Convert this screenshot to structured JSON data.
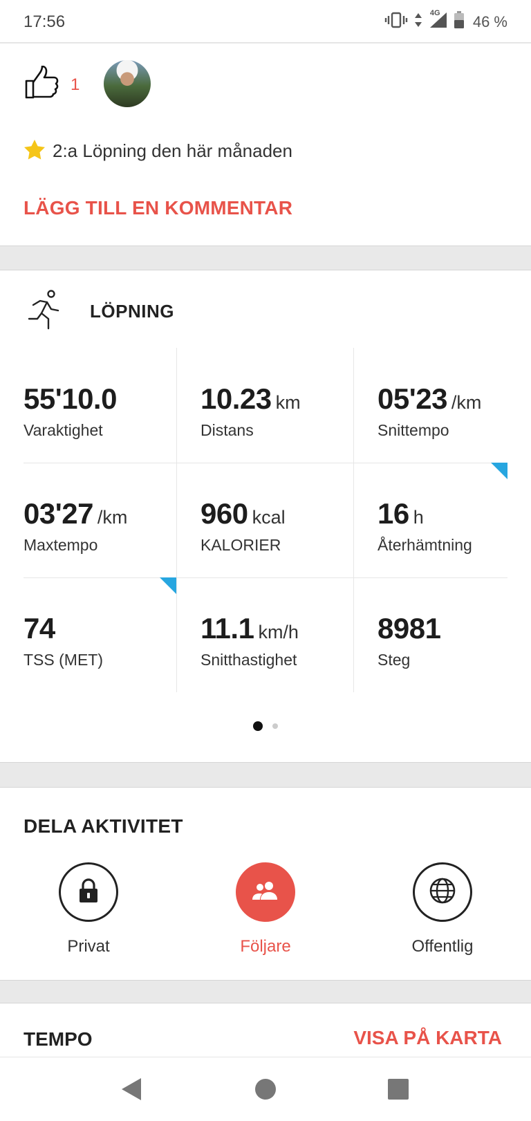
{
  "status_bar": {
    "time": "17:56",
    "network": "4G",
    "battery": "46 %"
  },
  "social": {
    "like_count": "1",
    "achievement": "2:a Löpning den här månaden",
    "add_comment": "LÄGG TILL EN KOMMENTAR"
  },
  "activity": {
    "title": "LÖPNING",
    "stats": [
      {
        "value": "55'10.0",
        "unit": "",
        "label": "Varaktighet"
      },
      {
        "value": "10.23",
        "unit": "km",
        "label": "Distans"
      },
      {
        "value": "05'23",
        "unit": "/km",
        "label": "Snittempo"
      },
      {
        "value": "03'27",
        "unit": "/km",
        "label": "Maxtempo"
      },
      {
        "value": "960",
        "unit": "kcal",
        "label": "KALORIER"
      },
      {
        "value": "16",
        "unit": "h",
        "label": "Återhämtning"
      },
      {
        "value": "74",
        "unit": "",
        "label": "TSS (MET)"
      },
      {
        "value": "11.1",
        "unit": "km/h",
        "label": "Snitthastighet"
      },
      {
        "value": "8981",
        "unit": "",
        "label": "Steg"
      }
    ]
  },
  "share": {
    "title": "DELA AKTIVITET",
    "options": [
      {
        "label": "Privat",
        "icon": "lock-icon"
      },
      {
        "label": "Följare",
        "icon": "followers-icon"
      },
      {
        "label": "Offentlig",
        "icon": "globe-icon"
      }
    ],
    "selected": "Följare"
  },
  "tempo": {
    "title": "TEMPO",
    "map_link": "VISA PÅ KARTA"
  },
  "colors": {
    "accent": "#e8534a",
    "corner_marker": "#27a6e0"
  }
}
